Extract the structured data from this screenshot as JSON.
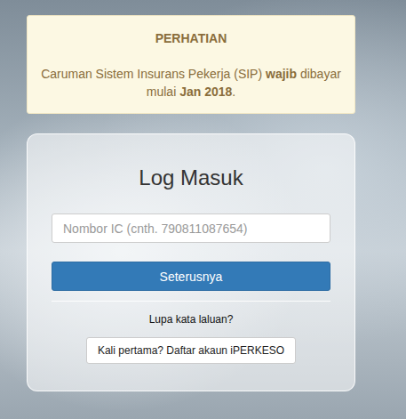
{
  "notice": {
    "title": "PERHATIAN",
    "message": [
      {
        "text": "Caruman Sistem Insurans Pekerja (SIP) ",
        "bold": false
      },
      {
        "text": "wajib",
        "bold": true
      },
      {
        "text": " dibayar mulai ",
        "bold": false
      },
      {
        "text": "Jan 2018",
        "bold": true
      },
      {
        "text": ".",
        "bold": false
      }
    ]
  },
  "login": {
    "title": "Log Masuk",
    "ic_input": {
      "placeholder": "Nombor IC (cnth. 790811087654)"
    },
    "next_button": "Seterusnya",
    "forgot_link": "Lupa kata laluan?",
    "register_button": "Kali pertama? Daftar akaun iPERKESO"
  }
}
